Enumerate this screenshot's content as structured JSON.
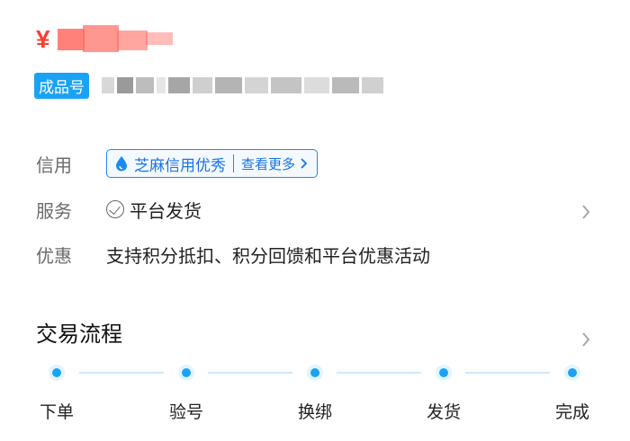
{
  "price": {
    "currency_symbol": "¥"
  },
  "product": {
    "badge_label": "成品号"
  },
  "info": {
    "credit": {
      "label": "信用",
      "tag_text": "芝麻信用优秀",
      "more_text": "查看更多",
      "tag_color": "#1b8cf2"
    },
    "service": {
      "label": "服务",
      "text": "平台发货"
    },
    "discount": {
      "label": "优惠",
      "text": "支持积分抵扣、积分回馈和平台优惠活动"
    }
  },
  "trade_flow": {
    "title": "交易流程",
    "steps": [
      {
        "label": "下单"
      },
      {
        "label": "验号"
      },
      {
        "label": "换绑"
      },
      {
        "label": "发货"
      },
      {
        "label": "完成"
      }
    ],
    "accent_color": "#1aa3f5"
  }
}
